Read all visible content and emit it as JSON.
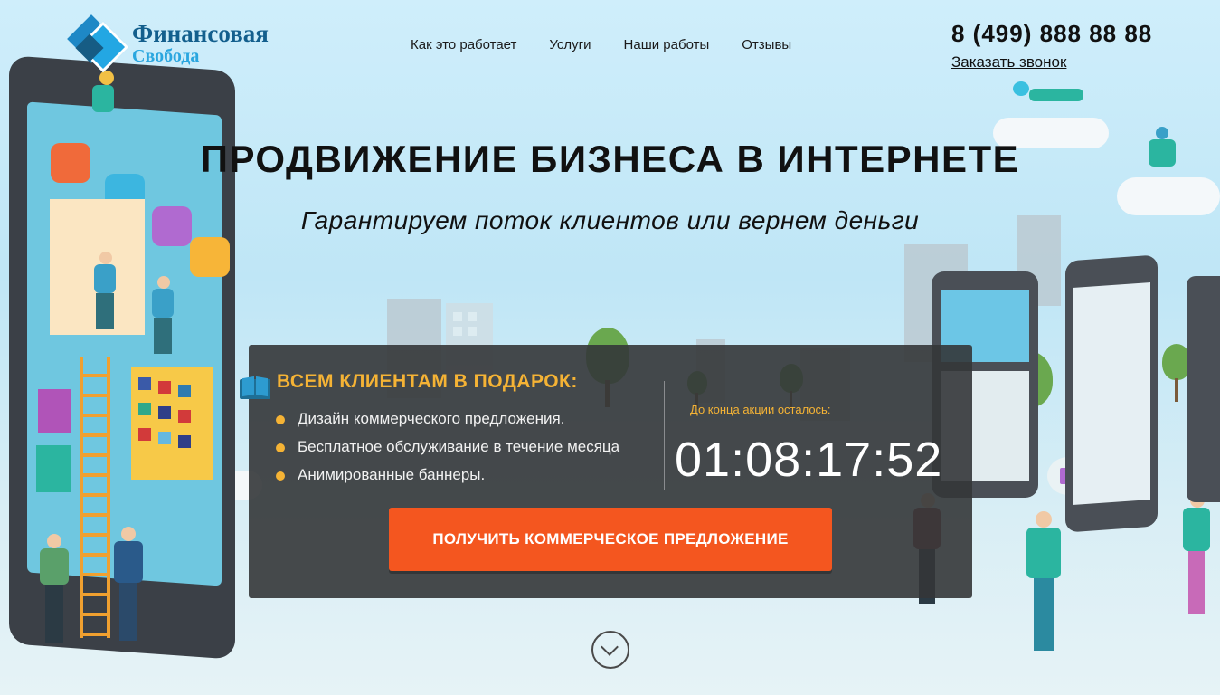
{
  "header": {
    "logo": {
      "line1": "Финансовая",
      "line2": "Свобода"
    },
    "nav": [
      {
        "label": "Как это работает"
      },
      {
        "label": "Услуги"
      },
      {
        "label": "Наши работы"
      },
      {
        "label": "Отзывы"
      }
    ],
    "phone": "8 (499) 888 88 88",
    "callback_label": "Заказать звонок"
  },
  "hero": {
    "title": "ПРОДВИЖЕНИЕ БИЗНЕСА В ИНТЕРНЕТЕ",
    "subtitle": "Гарантируем поток клиентов или вернем деньги"
  },
  "promo": {
    "title": "ВСЕМ КЛИЕНТАМ В ПОДАРОК:",
    "bullets": [
      "Дизайн коммерческого предложения.",
      "Бесплатное обслуживание в течение месяца",
      "Анимированные баннеры."
    ],
    "timer_label": "До конца акции осталось:",
    "timer": "01:08:17:52",
    "cta_label": "ПОЛУЧИТЬ КОММЕРЧЕСКОЕ ПРЕДЛОЖЕНИЕ"
  },
  "colors": {
    "accent_orange": "#f4561f",
    "accent_yellow": "#f5b335",
    "brand_dark_blue": "#135f8d",
    "brand_light_blue": "#2aa6df",
    "panel_bg": "#343639"
  },
  "icons": {
    "gift": "book-gift-icon",
    "scroll": "chevron-down-icon"
  }
}
